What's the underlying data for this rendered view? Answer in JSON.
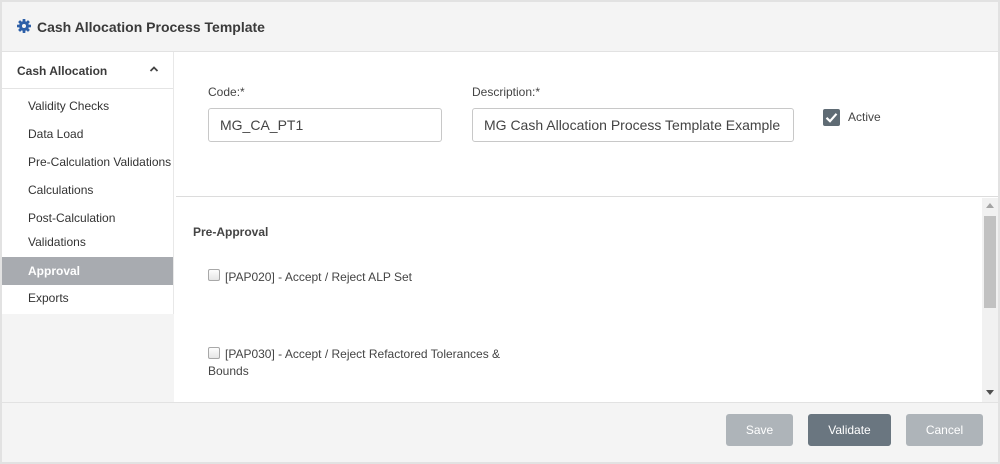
{
  "window": {
    "title": "Cash Allocation Process Template",
    "icon": "gear-icon",
    "accent_color": "#2c5fa8"
  },
  "sidebar": {
    "group_label": "Cash Allocation",
    "group_state": "expanded",
    "items": [
      {
        "label": "Validity Checks",
        "active": false
      },
      {
        "label": "Data Load",
        "active": false
      },
      {
        "label": "Pre-Calculation Validations",
        "active": false
      },
      {
        "label": "Calculations",
        "active": false
      },
      {
        "label": "Post-Calculation",
        "label2": "Validations",
        "active": false
      },
      {
        "label": "Approval",
        "active": true
      },
      {
        "label": "Exports",
        "active": false
      }
    ],
    "active_color": "#a8abb0"
  },
  "form": {
    "code_label": "Code:*",
    "code_value": "MG_CA_PT1",
    "description_label": "Description:*",
    "description_value": "MG Cash Allocation Process Template Example",
    "active_label": "Active",
    "active_checked": true
  },
  "approval": {
    "section_title": "Pre-Approval",
    "items": [
      {
        "label": "[PAP020] - Accept / Reject ALP Set",
        "checked": false
      },
      {
        "label": "[PAP030] - Accept / Reject Refactored Tolerances &",
        "label2": "Bounds",
        "checked": false
      }
    ]
  },
  "footer": {
    "save_label": "Save",
    "validate_label": "Validate",
    "cancel_label": "Cancel",
    "primary_color": "#6a7680",
    "disabled_color": "#aeb4b9"
  }
}
